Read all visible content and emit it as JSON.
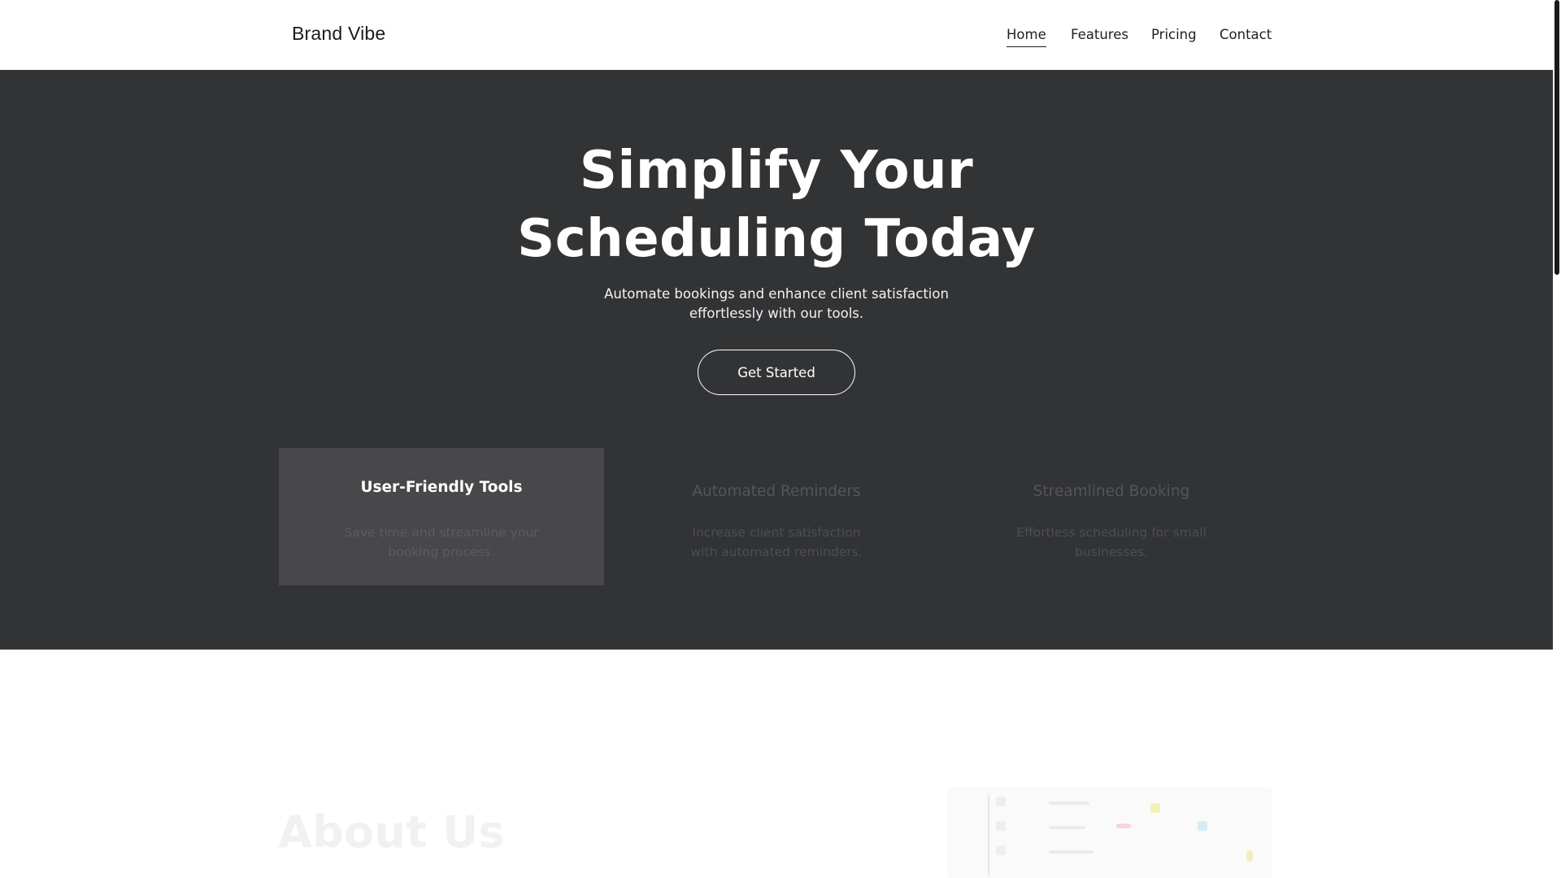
{
  "header": {
    "brand": "Brand Vibe",
    "nav": [
      {
        "label": "Home",
        "active": true
      },
      {
        "label": "Features",
        "active": false
      },
      {
        "label": "Pricing",
        "active": false
      },
      {
        "label": "Contact",
        "active": false
      }
    ]
  },
  "hero": {
    "title_line1": "Simplify Your",
    "title_line2": "Scheduling Today",
    "subtitle": "Automate bookings and enhance client satisfaction effortlessly with our tools.",
    "cta_label": "Get Started",
    "features": [
      {
        "title": "User-Friendly Tools",
        "text": "Save time and streamline your booking process.",
        "active": true
      },
      {
        "title": "Automated Reminders",
        "text": "Increase client satisfaction with automated reminders.",
        "active": false
      },
      {
        "title": "Streamlined Booking",
        "text": "Effortless scheduling for small businesses.",
        "active": false
      }
    ]
  },
  "about": {
    "title": "About Us"
  },
  "colors": {
    "hero_bg": "#323335",
    "card_active_bg": "#48484a",
    "text_dark": "#1f1f1f",
    "text_light": "#ffffff"
  },
  "icons": {
    "scroll_thumb": "scrollbar-thumb"
  }
}
